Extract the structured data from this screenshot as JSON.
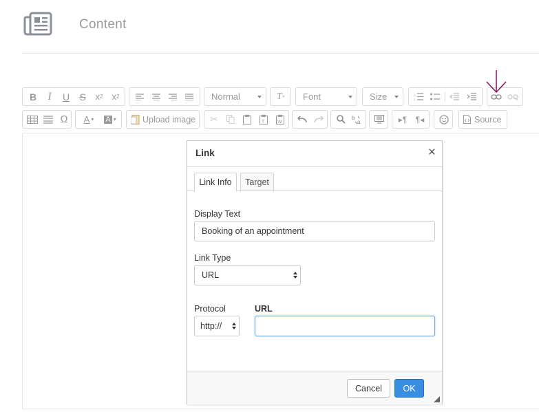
{
  "header": {
    "title": "Content",
    "icon": "newspaper-icon"
  },
  "toolbar": {
    "format_combo": "Normal",
    "font_combo": "Font",
    "size_combo": "Size",
    "upload_image": "Upload image",
    "source": "Source"
  },
  "annotation": {
    "arrow_icon": "arrow-down-icon",
    "color": "#8b1a5c"
  },
  "dialog": {
    "title": "Link",
    "close": "×",
    "tabs": [
      {
        "label": "Link Info",
        "active": true
      },
      {
        "label": "Target",
        "active": false
      }
    ],
    "display_text_label": "Display Text",
    "display_text_value": "Booking of an appointment",
    "link_type_label": "Link Type",
    "link_type_value": "URL",
    "protocol_label": "Protocol",
    "protocol_value": "http://",
    "url_label": "URL",
    "url_value": "",
    "cancel": "Cancel",
    "ok": "OK"
  },
  "colors": {
    "accent": "#3a8ee0",
    "focus_border": "#6ea7e1"
  }
}
